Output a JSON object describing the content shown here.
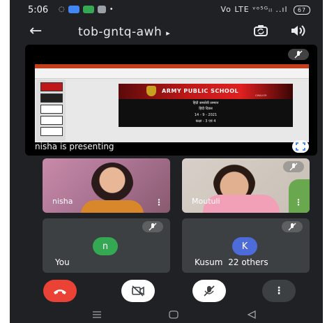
{
  "status": {
    "time": "5:06",
    "signal_text": "Vo LTE ᵛᵒ⁵ᴳᵢₗ ..ıl",
    "battery": "67"
  },
  "toolbar": {
    "meeting_code": "tob-gntq-awh",
    "caret": "▸"
  },
  "presentation": {
    "label": "nisha is presenting",
    "slide_title": "ARMY PUBLIC SCHOOL",
    "slide_subtitle": "GWALIOR",
    "slide_lines": [
      "हिंदी समसेवी सम्मान",
      "हिंदी दिवस",
      "14 - 9 - 2021",
      "कक्षा - 3 एवं 4"
    ]
  },
  "participants": {
    "tiles": [
      {
        "name": "nisha"
      },
      {
        "name": "Moutuli"
      }
    ],
    "self": {
      "initial": "n",
      "label": "You",
      "color": "#34a853"
    },
    "others": {
      "initial": "K",
      "label": "Kusum",
      "extra": "22 others",
      "color": "#4e6cd9"
    }
  },
  "colors": {
    "end_call": "#ea4335",
    "background": "#202124",
    "tile": "#3c4043"
  },
  "icons": {
    "end_call": "phone-hangup-icon",
    "camera": "camera-off-icon",
    "mic": "mic-off-icon",
    "more": "more-vertical-icon"
  }
}
